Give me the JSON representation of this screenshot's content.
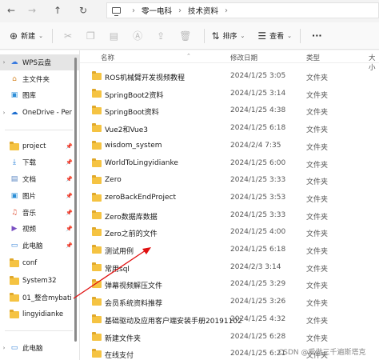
{
  "nav": {
    "back_icon": "arrow-left-icon",
    "forward_icon": "arrow-right-icon",
    "up_icon": "arrow-up-icon",
    "refresh_icon": "refresh-icon"
  },
  "breadcrumb": [
    "零一电科",
    "技术资料"
  ],
  "toolbar": {
    "new_label": "新建",
    "sort_label": "排序",
    "view_label": "查看",
    "more_label": "···"
  },
  "sidebar": {
    "items": [
      {
        "label": "WPS云盘",
        "icon": "wps-cloud-icon",
        "expandable": true
      },
      {
        "label": "主文件夹",
        "icon": "home-icon"
      },
      {
        "label": "图库",
        "icon": "gallery-icon"
      },
      {
        "label": "OneDrive - Per",
        "icon": "onedrive-icon",
        "expandable": true
      },
      {
        "label": "project",
        "icon": "folder-icon",
        "pinned": true
      },
      {
        "label": "下载",
        "icon": "download-icon",
        "pinned": true
      },
      {
        "label": "文档",
        "icon": "document-icon",
        "pinned": true
      },
      {
        "label": "图片",
        "icon": "picture-icon",
        "pinned": true
      },
      {
        "label": "音乐",
        "icon": "music-icon",
        "pinned": true
      },
      {
        "label": "视频",
        "icon": "video-icon",
        "pinned": true
      },
      {
        "label": "此电脑",
        "icon": "pc-icon",
        "pinned": true
      },
      {
        "label": "conf",
        "icon": "folder-icon"
      },
      {
        "label": "System32",
        "icon": "folder-icon"
      },
      {
        "label": "01_整合mybati",
        "icon": "folder-icon"
      },
      {
        "label": "lingyidianke",
        "icon": "folder-icon"
      },
      {
        "label": "此电脑",
        "icon": "pc-icon",
        "expandable": true
      }
    ]
  },
  "columns": {
    "name": "名称",
    "date": "修改日期",
    "type": "类型",
    "size": "大小"
  },
  "files": [
    {
      "name": "ROS机械臂开发视频教程",
      "date": "2024/1/25 3:05",
      "type": "文件夹"
    },
    {
      "name": "SpringBoot2资料",
      "date": "2024/1/25 3:14",
      "type": "文件夹"
    },
    {
      "name": "SpringBoot资料",
      "date": "2024/1/25 4:38",
      "type": "文件夹"
    },
    {
      "name": "Vue2和Vue3",
      "date": "2024/1/25 6:18",
      "type": "文件夹"
    },
    {
      "name": "wisdom_system",
      "date": "2024/2/4 7:35",
      "type": "文件夹"
    },
    {
      "name": "WorldToLingyidianke",
      "date": "2024/1/25 6:00",
      "type": "文件夹"
    },
    {
      "name": "Zero",
      "date": "2024/1/25 3:33",
      "type": "文件夹"
    },
    {
      "name": "zeroBackEndProject",
      "date": "2024/1/25 3:53",
      "type": "文件夹"
    },
    {
      "name": "Zero数据库数据",
      "date": "2024/1/25 3:33",
      "type": "文件夹"
    },
    {
      "name": "Zero之前的文件",
      "date": "2024/1/25 4:00",
      "type": "文件夹"
    },
    {
      "name": "测试用例",
      "date": "2024/1/25 6:18",
      "type": "文件夹"
    },
    {
      "name": "常用sql",
      "date": "2024/2/3 3:14",
      "type": "文件夹"
    },
    {
      "name": "弹幕视频解压文件",
      "date": "2024/1/25 3:29",
      "type": "文件夹"
    },
    {
      "name": "会员系统资料推荐",
      "date": "2024/1/25 3:26",
      "type": "文件夹"
    },
    {
      "name": "基础驱动及应用客户端安装手册20191102",
      "date": "2024/1/25 4:32",
      "type": "文件夹"
    },
    {
      "name": "新建文件夹",
      "date": "2024/1/25 6:28",
      "type": "文件夹"
    },
    {
      "name": "在线支付",
      "date": "2024/1/25 6:21",
      "type": "文件夹"
    }
  ],
  "watermark": "CSDN @爱做三千遍斯塔克",
  "colors": {
    "folder": "#f5c342",
    "selected": "#e5e5e5",
    "arrow": "#e01010"
  }
}
